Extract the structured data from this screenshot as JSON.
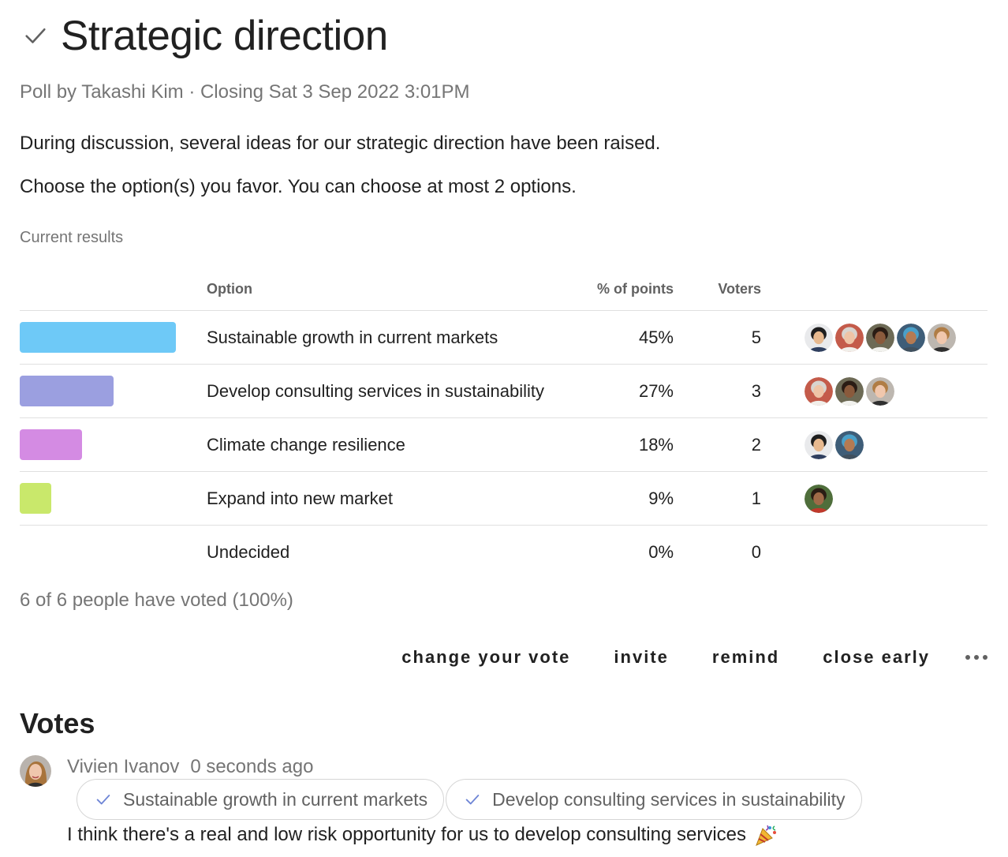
{
  "poll": {
    "title": "Strategic direction",
    "meta": "Poll by Takashi Kim · Closing Sat 3 Sep 2022 3:01PM",
    "description_1": "During discussion, several ideas for our strategic direction have been raised.",
    "description_2": "Choose the option(s) you favor. You can choose at most 2 options.",
    "results_label": "Current results"
  },
  "table": {
    "headers": {
      "option": "Option",
      "points": "% of points",
      "voters": "Voters"
    },
    "rows": [
      {
        "option": "Sustainable growth in current markets",
        "points": "45%",
        "voters": "5",
        "share": 0.45,
        "color": "#6ec9f7",
        "avatars": [
          "avatar-man-suit",
          "avatar-woman-gray",
          "avatar-woman-dark",
          "avatar-man-turban",
          "avatar-woman-blonde"
        ]
      },
      {
        "option": "Develop consulting services in sustainability",
        "points": "27%",
        "voters": "3",
        "share": 0.27,
        "color": "#9b9fe0",
        "avatars": [
          "avatar-woman-gray",
          "avatar-woman-dark",
          "avatar-woman-blonde"
        ]
      },
      {
        "option": "Climate change resilience",
        "points": "18%",
        "voters": "2",
        "share": 0.18,
        "color": "#d48be3",
        "avatars": [
          "avatar-man-suit",
          "avatar-man-turban"
        ]
      },
      {
        "option": "Expand into new market",
        "points": "9%",
        "voters": "1",
        "share": 0.09,
        "color": "#c9e86b",
        "avatars": [
          "avatar-couple"
        ]
      },
      {
        "option": "Undecided",
        "points": "0%",
        "voters": "0",
        "share": 0,
        "color": "#ffffff",
        "avatars": []
      }
    ]
  },
  "voted_summary": "6 of 6 people have voted (100%)",
  "actions": {
    "change_vote": "change your vote",
    "invite": "invite",
    "remind": "remind",
    "close_early": "close early",
    "more_icon": "more-horizontal-icon"
  },
  "votes": {
    "heading": "Votes",
    "entries": [
      {
        "name": "Vivien Ivanov",
        "time": "0 seconds ago",
        "choices": [
          "Sustainable growth in current markets",
          "Develop consulting services in sustainability"
        ],
        "comment": "I think there's a real and low risk opportunity for us to develop consulting services"
      }
    ]
  },
  "colors": {
    "accent": "#6f86d6",
    "muted_text": "#757575",
    "divider": "#e0e0e0"
  }
}
